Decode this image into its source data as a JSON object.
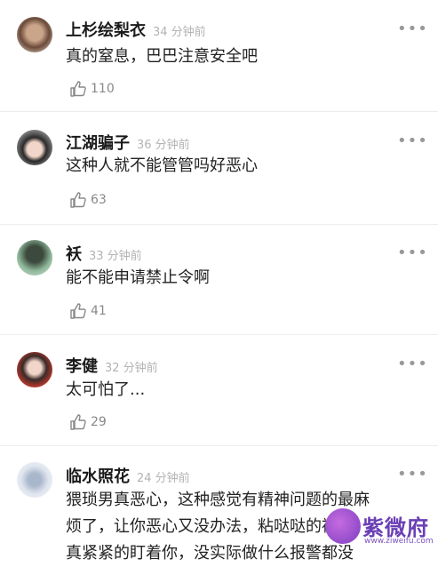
{
  "comments": [
    {
      "name": "上杉绘梨衣",
      "time": "34 分钟前",
      "text": "真的窒息，巴巴注意安全吧",
      "likes": "110"
    },
    {
      "name": "江湖骗子",
      "time": "36 分钟前",
      "text": "这种人就不能管管吗好恶心",
      "likes": "63"
    },
    {
      "name": "袄",
      "time": "33 分钟前",
      "text": "能不能申请禁止令啊",
      "likes": "41"
    },
    {
      "name": "李健",
      "time": "32 分钟前",
      "text": "太可怕了...",
      "likes": "29"
    },
    {
      "name": "临水照花",
      "time": "24 分钟前",
      "text": "猥琐男真恶心，这种感觉有精神问题的最麻\n烦了，让你恶心又没办法，粘哒哒的被\n真紧紧的盯着你，没实际做什么报警都没"
    }
  ],
  "more_label": "•••",
  "watermark": {
    "brand": "紫微府",
    "url": "www.ziweifu.com"
  }
}
